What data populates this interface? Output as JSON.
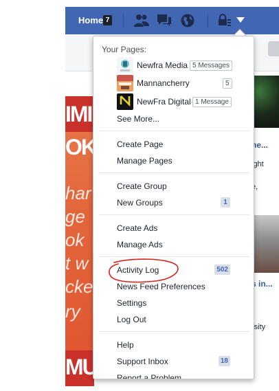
{
  "topbar": {
    "home_label": "Home",
    "home_count": "7",
    "icons": [
      "friend-requests-icon",
      "messages-icon",
      "notifications-globe-icon",
      "privacy-lock-icon",
      "account-menu-chevron-icon"
    ],
    "brand_color": "#4267b2"
  },
  "dropdown": {
    "pages_header": "Your Pages:",
    "pages": [
      {
        "name": "Newfra Media",
        "badge": "5 Messages"
      },
      {
        "name": "Mannancherry",
        "badge": "5"
      },
      {
        "name": "NewFra Digital",
        "badge": "1 Message"
      }
    ],
    "see_more": "See More...",
    "create_page": "Create Page",
    "manage_pages": "Manage Pages",
    "create_group": "Create Group",
    "new_groups": "New Groups",
    "new_groups_count": "1",
    "create_ads": "Create Ads",
    "manage_ads": "Manage Ads",
    "activity_log": "Activity Log",
    "activity_log_count": "502",
    "news_feed_preferences": "News Feed Preferences",
    "settings": "Settings",
    "log_out": "Log Out",
    "help": "Help",
    "support_inbox": "Support Inbox",
    "support_inbox_count": "18",
    "report_problem": "Report a Problem"
  },
  "background": {
    "promo_lines": [
      "IMI",
      "OK",
      "har",
      "ge",
      "ok",
      "t w",
      "cke",
      "ry",
      "MU"
    ],
    "right_texts": [
      "ight",
      "e,",
      "rsity"
    ],
    "right_links": [
      "he...",
      "s in..."
    ]
  },
  "annotation": {
    "color": "#d9201b"
  },
  "newfra_logo_text": "NewFra"
}
